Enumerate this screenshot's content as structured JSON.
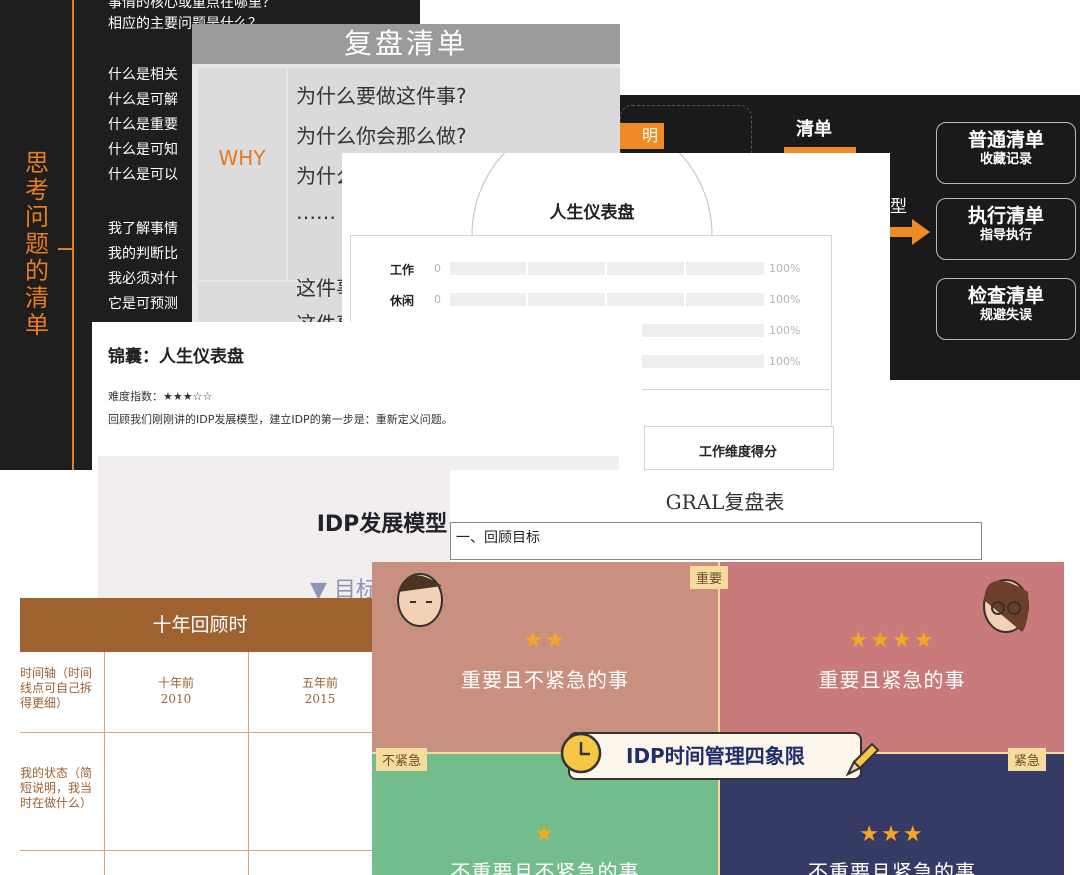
{
  "think": {
    "title_chars": [
      "思",
      "考",
      "问",
      "题",
      "的",
      "清",
      "单"
    ],
    "lines": [
      "事情的核心或重点在哪里？",
      "相应的主要问题是什么？",
      "什么是相关",
      "什么是可解",
      "什么是重要",
      "什么是可知",
      "什么是可以",
      "我了解事情",
      "我的判断比",
      "我必须对什",
      "它是可预测"
    ]
  },
  "list_card": {
    "label_top": "清单",
    "label_left_partial": "型",
    "orange_partial": "明",
    "boxes": [
      {
        "title": "普通清单",
        "sub": "收藏记录"
      },
      {
        "title": "执行清单",
        "sub": "指导执行"
      },
      {
        "title": "检查清单",
        "sub": "规避失误"
      }
    ],
    "accent": "#f08a24"
  },
  "review": {
    "title": "复盘清单",
    "why": "WHY",
    "questions": [
      "为什么要做这件事?",
      "为什么你会那么做?",
      "为什么",
      "……"
    ],
    "row2": [
      "这件事",
      "这件事"
    ]
  },
  "dashboard": {
    "title": "人生仪表盘",
    "rows": [
      {
        "label": "工作",
        "value": "0",
        "max": "100%"
      },
      {
        "label": "休闲",
        "value": "0",
        "max": "100%"
      },
      {
        "label": "",
        "value": "",
        "max": "100%"
      },
      {
        "label": "",
        "value": "",
        "max": "100%"
      }
    ],
    "score_header": "工作维度得分"
  },
  "idp": {
    "title": "锦囊：人生仪表盘",
    "difficulty": "难度指数：★★★☆☆",
    "desc": "回顾我们刚刚讲的IDP发展模型，建立IDP的第一步是：重新定义问题。",
    "model": "IDP发展模型",
    "goal": "▼ 目标"
  },
  "gral": {
    "title": "GRAL复盘表",
    "item": "一、回顾目标"
  },
  "ten_year": {
    "title": "十年回顾时",
    "row1_label": "时间轴（时间\n线点可自己拆\n得更细）",
    "cols": [
      {
        "label": "十年前",
        "year": "2010"
      },
      {
        "label": "五年前",
        "year": "2015"
      }
    ],
    "row2_label": "我的状态（简\n短说明，我当\n时在做什么）"
  },
  "quadrant": {
    "banner": "IDP时间管理四象限",
    "tag_important": "重要",
    "tag_not_urgent": "不紧急",
    "tag_urgent": "紧急",
    "quads": [
      {
        "text": "重要且不紧急的事",
        "stars": "★★",
        "color": "#c98f7f"
      },
      {
        "text": "重要且紧急的事",
        "stars": "★★★★",
        "color": "#c97a7b"
      },
      {
        "text": "不重要且不紧急的事",
        "stars": "★",
        "color": "#72bd8b"
      },
      {
        "text": "不重要且紧急的事",
        "stars": "★★★",
        "color": "#363b66"
      }
    ]
  }
}
